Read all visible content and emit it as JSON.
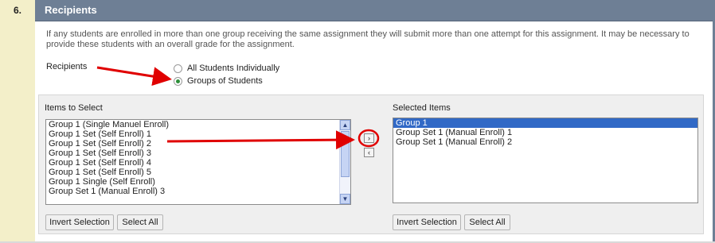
{
  "section": {
    "number": "6.",
    "title": "Recipients"
  },
  "description": "If any students are enrolled in more than one group receiving the same assignment they will submit more than one attempt for this assignment. It may be necessary to provide these students with an overall grade for the assignment.",
  "recipients": {
    "label": "Recipients",
    "options": [
      {
        "label": "All Students Individually",
        "checked": false
      },
      {
        "label": "Groups of Students",
        "checked": true
      }
    ]
  },
  "picker": {
    "left_label": "Items to Select",
    "right_label": "Selected Items",
    "available_items": [
      "Group 1 (Single Manuel Enroll)",
      "Group 1 Set (Self Enroll) 1",
      "Group 1 Set (Self Enroll) 2",
      "Group 1 Set (Self Enroll) 3",
      "Group 1 Set (Self Enroll) 4",
      "Group 1 Set (Self Enroll) 5",
      "Group 1 Single (Self Enroll)",
      "Group Set 1 (Manual Enroll) 3"
    ],
    "selected_items": [
      {
        "label": "Group 1",
        "highlighted": true
      },
      {
        "label": "Group Set 1 (Manual Enroll) 1",
        "highlighted": false
      },
      {
        "label": "Group Set 1 (Manual Enroll) 2",
        "highlighted": false
      }
    ],
    "move_right_glyph": "›",
    "move_left_glyph": "‹",
    "left_buttons": {
      "invert": "Invert Selection",
      "select_all": "Select All"
    },
    "right_buttons": {
      "invert": "Invert Selection",
      "select_all": "Select All"
    }
  },
  "colors": {
    "header": "#6e7f95",
    "step_bg": "#f3efc9",
    "annotation": "#e00000",
    "selection": "#3169c6"
  }
}
